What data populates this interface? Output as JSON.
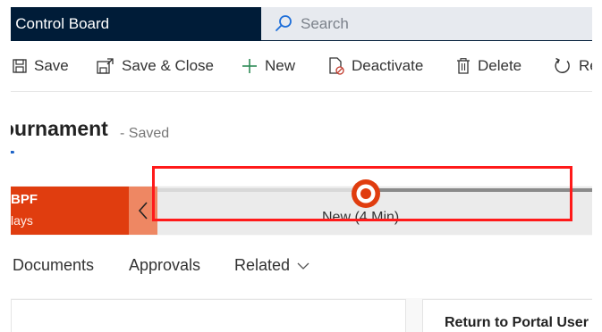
{
  "header": {
    "app_title": "s Control Board",
    "search_placeholder": "Search"
  },
  "commandbar": {
    "save": "Save",
    "save_close": "Save & Close",
    "new": "New",
    "deactivate": "Deactivate",
    "delete": "Delete",
    "refresh": "Re"
  },
  "record": {
    "title": "ournament",
    "saved_status": "- Saved"
  },
  "bpf": {
    "name": "BPF",
    "duration": "lays",
    "stage_label": "New (4 Min)"
  },
  "tabs": [
    "Documents",
    "Approvals",
    "Related"
  ],
  "panels": {
    "right_title": "Return to Portal User"
  },
  "colors": {
    "header_bg": "#001c38",
    "bpf_flag": "#e03d0f",
    "bpf_back": "#ee8763",
    "highlight": "#ff1a1a",
    "stage_marker": "#e03d0f"
  }
}
